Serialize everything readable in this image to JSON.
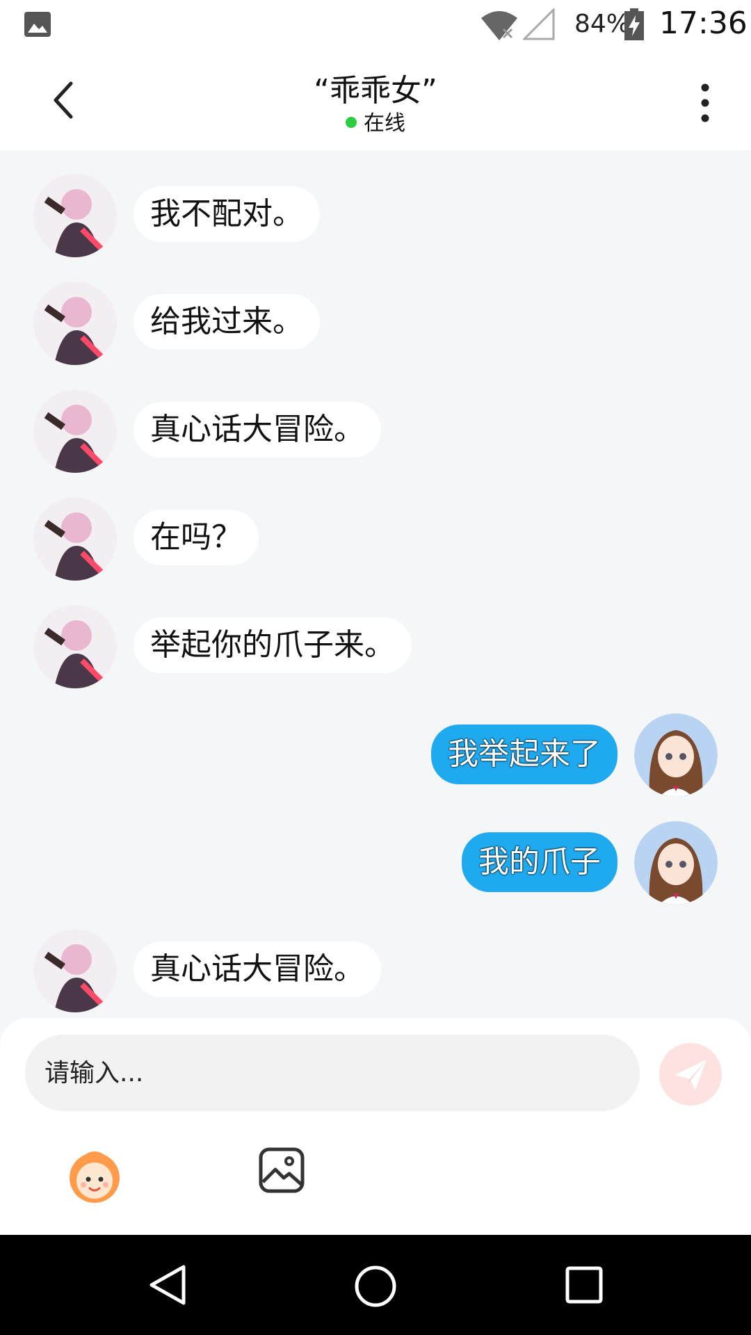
{
  "status_bar": {
    "battery": "84%",
    "time": "17:36"
  },
  "header": {
    "title": "“乖乖女”",
    "status": "在线"
  },
  "messages": [
    {
      "side": "in",
      "text": "我不配对。"
    },
    {
      "side": "in",
      "text": "给我过来。"
    },
    {
      "side": "in",
      "text": "真心话大冒险。"
    },
    {
      "side": "in",
      "text": "在吗？"
    },
    {
      "side": "in",
      "text": "举起你的爪子来。"
    },
    {
      "side": "out",
      "text": "我举起来了"
    },
    {
      "side": "out",
      "text": "我的爪子"
    },
    {
      "side": "in",
      "text": "真心话大冒险。"
    }
  ],
  "input": {
    "placeholder": "请输入..."
  },
  "colors": {
    "outgoing_bubble": "#1faaf0",
    "incoming_bubble": "#ffffff",
    "online_dot": "#2ecc40",
    "send_button": "#fde2e0"
  },
  "icons": [
    "gallery-icon",
    "wifi-icon",
    "signal-icon",
    "battery-icon",
    "back-arrow-icon",
    "more-vertical-icon",
    "send-icon",
    "emoji-icon",
    "image-icon",
    "nav-back-icon",
    "nav-home-icon",
    "nav-recent-icon"
  ]
}
